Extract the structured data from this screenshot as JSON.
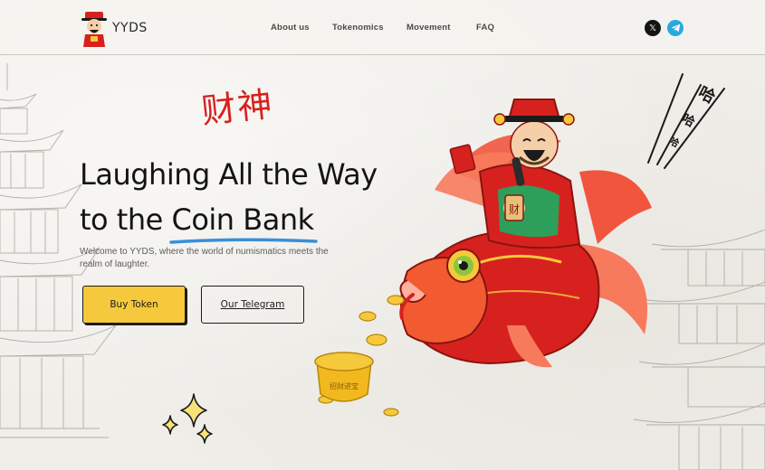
{
  "brand": {
    "name": "YYDS",
    "logo_icon": "caishen-mascot-icon"
  },
  "nav": {
    "items": [
      {
        "label": "About us"
      },
      {
        "label": "Tokenomics"
      },
      {
        "label": "Movement"
      },
      {
        "label": "FAQ"
      }
    ]
  },
  "social": {
    "x_icon": "x-twitter-icon",
    "x_glyph": "𝕏",
    "telegram_icon": "telegram-icon"
  },
  "hero": {
    "chinese_title": "财神",
    "headline_line1": "Laughing All the Way",
    "headline_line2_prefix": "to the ",
    "headline_line2_highlight": "Coin Bank",
    "subtitle": "Welcome to YYDS, where the world of numismatics meets the realm of laughter.",
    "buy_button": "Buy Token",
    "telegram_button": "Our Telegram"
  },
  "decor": {
    "haha": [
      "哈",
      "哈",
      "哈"
    ],
    "ingot_text": "招财进宝",
    "fortune_badge": "财"
  },
  "colors": {
    "accent_red": "#d7211f",
    "button_yellow": "#f6c93c",
    "telegram_blue": "#29a8e0",
    "underline_blue": "#3a8fd8"
  }
}
